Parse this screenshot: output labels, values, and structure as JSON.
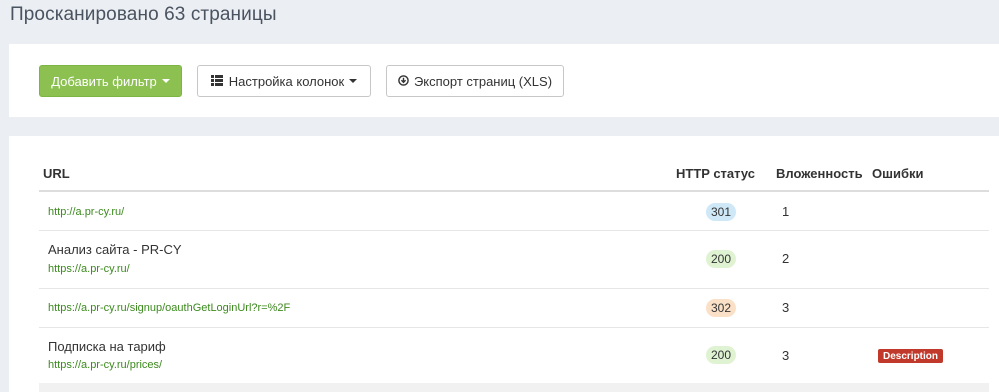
{
  "page": {
    "title": "Просканировано 63 страницы"
  },
  "toolbar": {
    "add_filter_label": "Добавить фильтр",
    "columns_label": "Настройка колонок",
    "export_label": "Экспорт страниц (XLS)",
    "accent_color": "#8cc152"
  },
  "table": {
    "columns": {
      "url": "URL",
      "http_status": "HTTP статус",
      "depth": "Вложенность",
      "errors": "Ошибки"
    },
    "rows": [
      {
        "title": "",
        "url": "http://a.pr-cy.ru/",
        "status": "301",
        "depth": "1",
        "error": ""
      },
      {
        "title": "Анализ сайта - PR-CY",
        "url": "https://a.pr-cy.ru/",
        "status": "200",
        "depth": "2",
        "error": ""
      },
      {
        "title": "",
        "url": "https://a.pr-cy.ru/signup/oauthGetLoginUrl?r=%2F",
        "status": "302",
        "depth": "3",
        "error": ""
      },
      {
        "title": "Подписка на тариф",
        "url": "https://a.pr-cy.ru/prices/",
        "status": "200",
        "depth": "3",
        "error": "Description"
      }
    ]
  },
  "status_colors": {
    "301": "#cfe8f7",
    "200": "#dff3d3",
    "302": "#fbe0c8",
    "error": "#c0392b"
  },
  "icons": [
    "list-icon",
    "download-icon",
    "caret-down-icon"
  ]
}
